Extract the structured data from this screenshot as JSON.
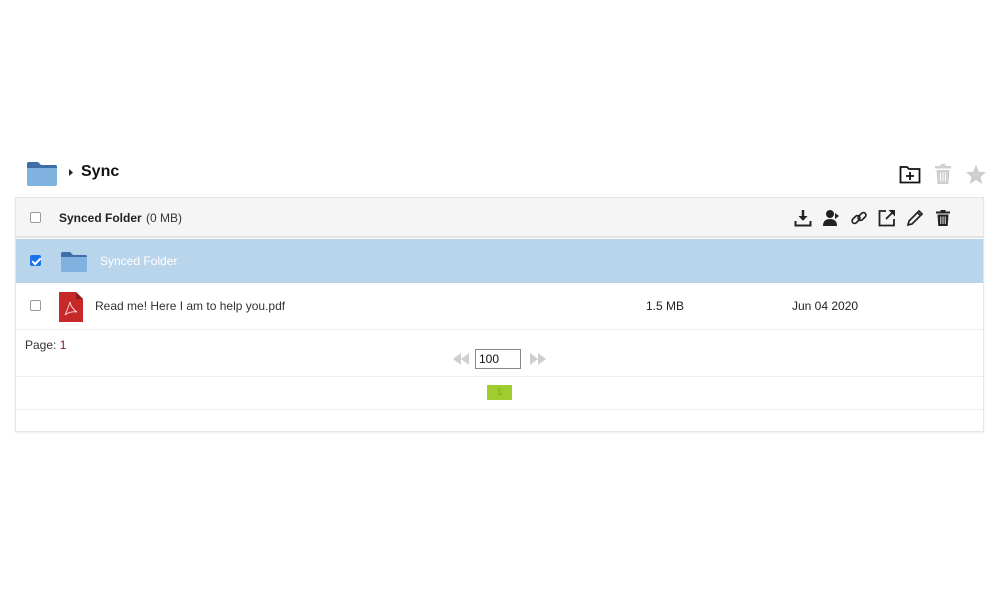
{
  "breadcrumb": {
    "title": "Sync",
    "folder_icon": "folder-icon",
    "separator_icon": "caret-right-icon"
  },
  "header_actions": [
    {
      "name": "new-folder-icon",
      "enabled": true
    },
    {
      "name": "trash-icon",
      "enabled": false
    },
    {
      "name": "star-icon",
      "enabled": false
    }
  ],
  "table_header": {
    "title": "Synced Folder",
    "size": "(0 MB)",
    "actions": [
      "download-icon",
      "share-user-icon",
      "link-icon",
      "open-external-icon",
      "edit-pencil-icon",
      "delete-icon"
    ]
  },
  "rows": [
    {
      "name": "Synced Folder",
      "type": "folder",
      "size": "",
      "date": "",
      "checked": true,
      "selected": true
    },
    {
      "name": "Read me! Here I am to help you.pdf",
      "type": "pdf",
      "size": "1.5 MB",
      "date": "Jun 04 2020",
      "checked": false,
      "selected": false
    }
  ],
  "pagination": {
    "label": "Page:",
    "current": "1",
    "per_page": "100",
    "pages": [
      "1"
    ]
  },
  "colors": {
    "selected_row": "#b9d5ec",
    "folder": "#7fb3e0",
    "pdf": "#c62828",
    "page_active": "#9fcc2e"
  }
}
